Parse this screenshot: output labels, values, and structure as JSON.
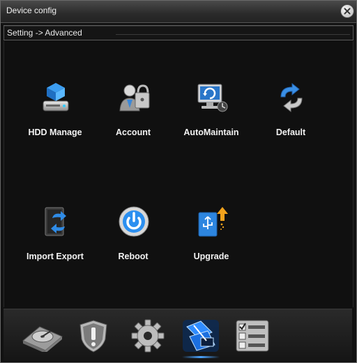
{
  "window": {
    "title": "Device config"
  },
  "breadcrumb": {
    "text": "Setting -> Advanced"
  },
  "tiles": [
    {
      "label": "HDD Manage",
      "icon": "hdd-manage-icon"
    },
    {
      "label": "Account",
      "icon": "account-icon"
    },
    {
      "label": "AutoMaintain",
      "icon": "auto-maintain-icon"
    },
    {
      "label": "Default",
      "icon": "default-icon"
    },
    {
      "label": "Import Export",
      "icon": "import-export-icon"
    },
    {
      "label": "Reboot",
      "icon": "reboot-icon"
    },
    {
      "label": "Upgrade",
      "icon": "upgrade-icon"
    }
  ],
  "bottom_nav": {
    "items": [
      {
        "icon": "storage-disk-icon",
        "active": false
      },
      {
        "icon": "alarm-shield-icon",
        "active": false
      },
      {
        "icon": "system-gear-icon",
        "active": false
      },
      {
        "icon": "advanced-tools-icon",
        "active": true
      },
      {
        "icon": "info-checklist-icon",
        "active": false
      }
    ]
  },
  "colors": {
    "accent": "#4aa3ff",
    "background": "#101010",
    "text": "#f2f2f2"
  }
}
